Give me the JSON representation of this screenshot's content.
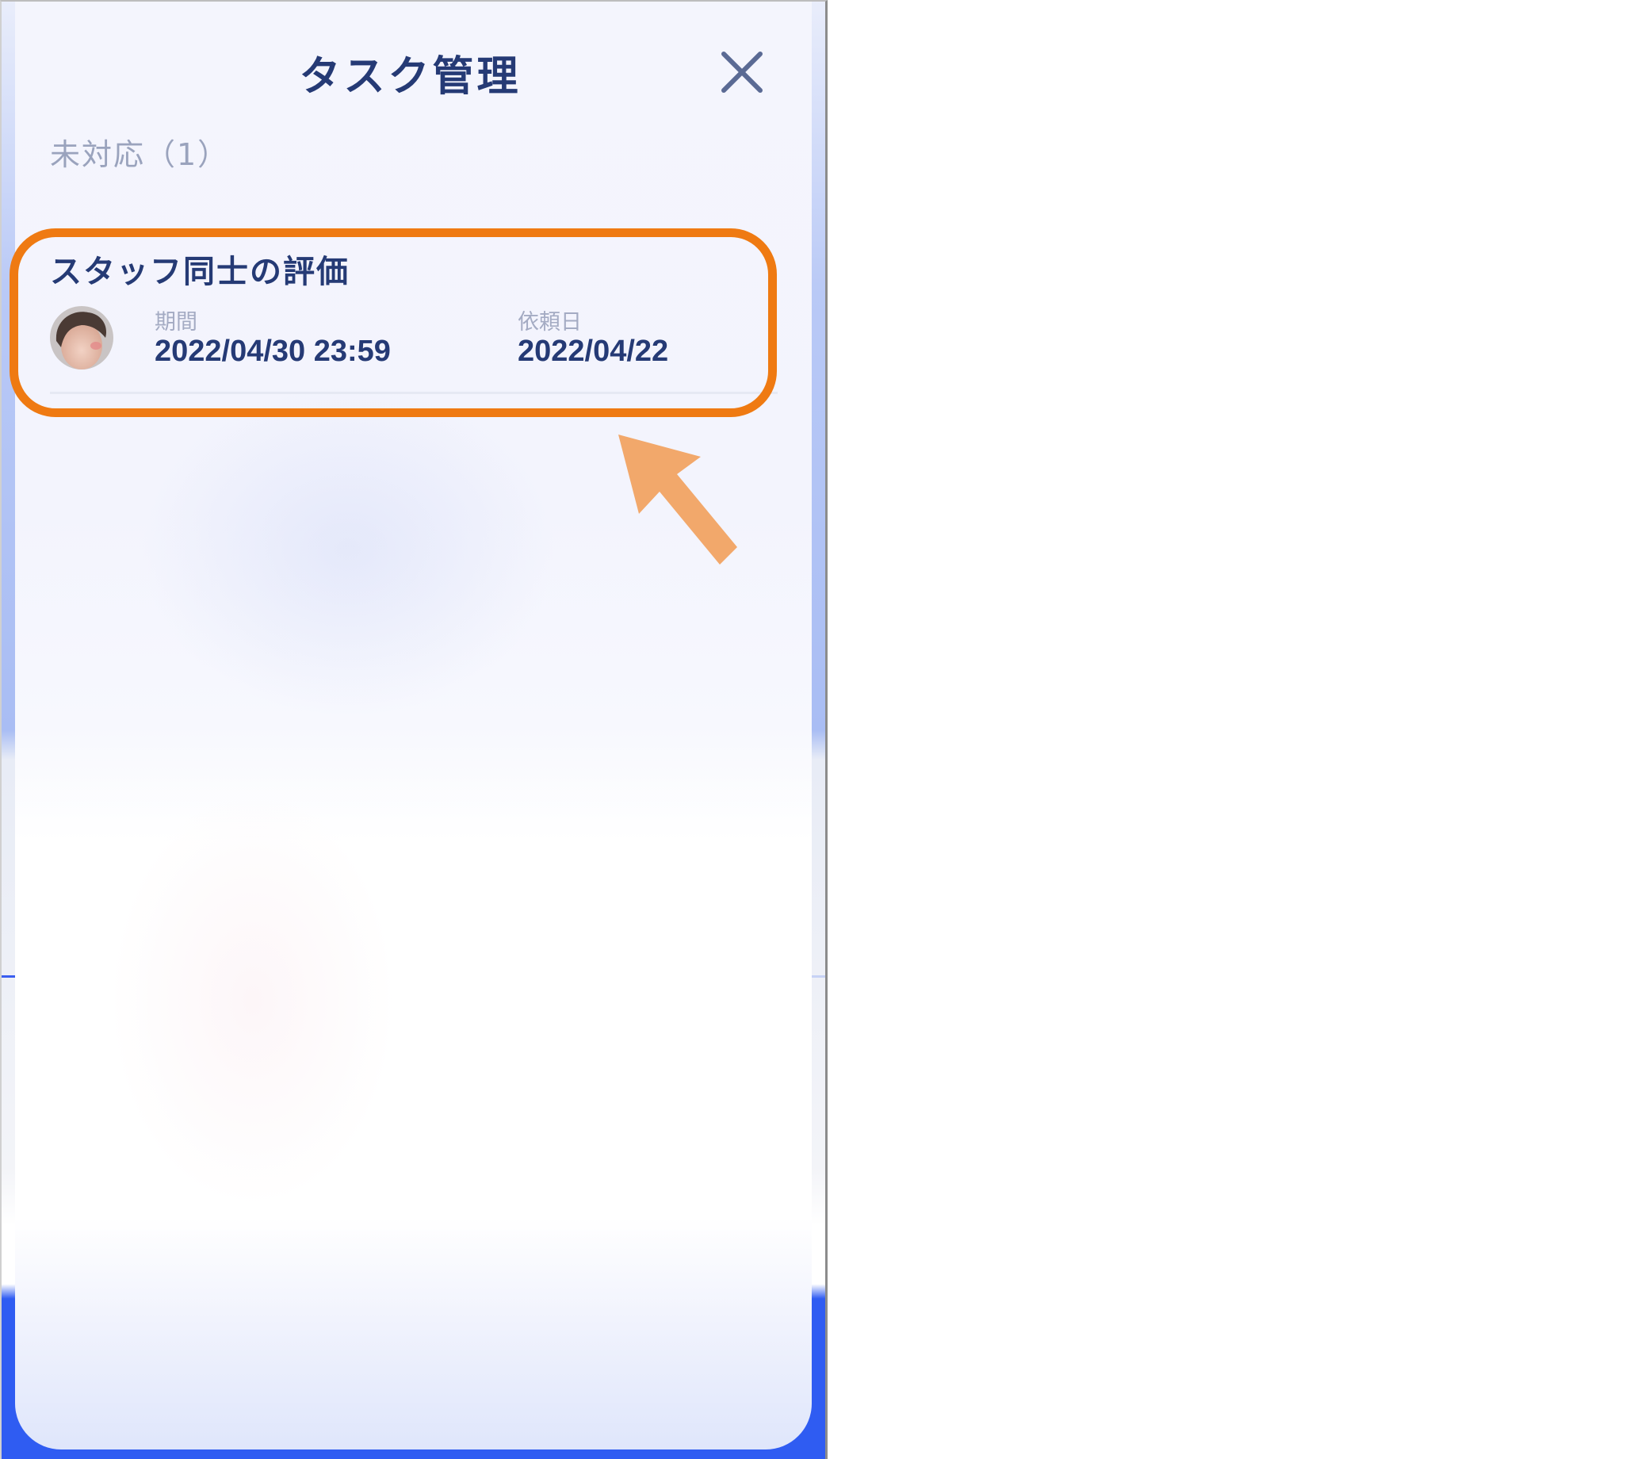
{
  "modal": {
    "title": "タスク管理",
    "close_icon": "close-icon"
  },
  "section": {
    "label": "未対応（1）"
  },
  "task": {
    "title": "スタッフ同士の評価",
    "avatar_icon": "avatar",
    "deadline_label": "期間",
    "deadline_value": "2022/04/30 23:59",
    "request_label": "依頼日",
    "request_value": "2022/04/22"
  },
  "annotation": {
    "highlight_color": "#ef7a12",
    "arrow_color": "#f2a86b",
    "arrow_icon": "arrow-up-left-icon"
  },
  "colors": {
    "text_primary": "#253a75",
    "text_muted": "#9aa3bd",
    "accent_blue": "#2f5cf2"
  }
}
